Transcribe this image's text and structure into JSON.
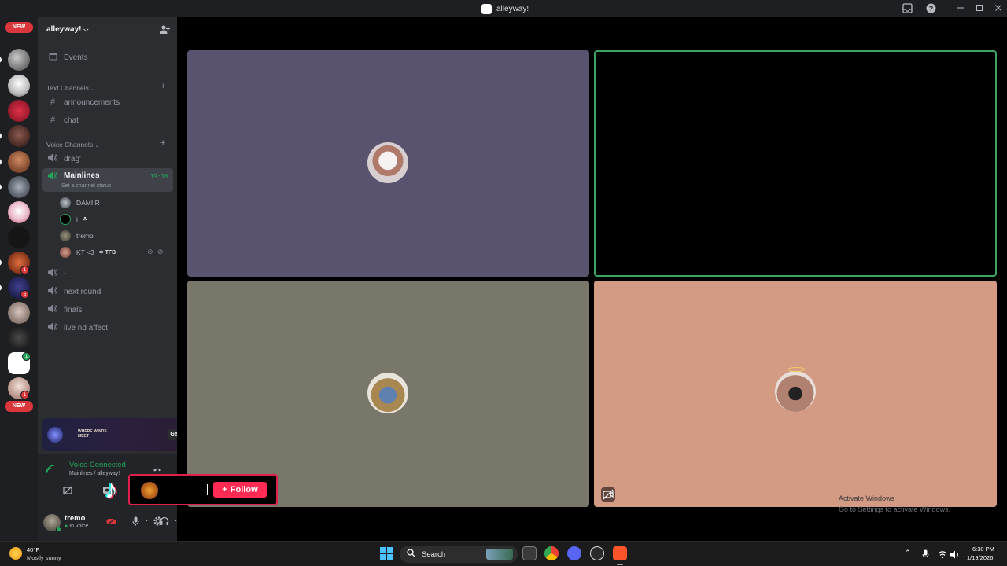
{
  "window": {
    "title": "alleyway!"
  },
  "server_rail": {
    "new_badge_top": "NEW",
    "new_badge_bottom": "NEW",
    "mentions": [
      "1",
      "5",
      "1",
      "1"
    ]
  },
  "guild": {
    "name": "alleyway!"
  },
  "channels": {
    "events_label": "Events",
    "text_category": "Text Channels",
    "text": [
      "announcements",
      "chat"
    ],
    "voice_category": "Voice Channels",
    "voice_first": "drag'",
    "active_voice": {
      "name": "Mainlines",
      "timer": "19:16",
      "status": "Set a channel status"
    },
    "members": [
      {
        "name": "DAMIIR",
        "tag": ""
      },
      {
        "name": "i",
        "tag": ""
      },
      {
        "name": "tremo",
        "tag": ""
      },
      {
        "name": "KT <3",
        "tag": "TFB"
      }
    ],
    "voice_rest": [
      "-",
      "next round",
      "finals",
      "live nd affect"
    ]
  },
  "promo": {
    "brand": "WHERE WINDS MEET",
    "button": "Get Reward!"
  },
  "voice_panel": {
    "status": "Voice Connected",
    "location": "Mainlines / alleyway!"
  },
  "user": {
    "name": "tremo",
    "status": "In voice"
  },
  "tiktok": {
    "follow": "Follow"
  },
  "activation": {
    "line1": "Activate Windows",
    "line2": "Go to Settings to activate Windows."
  },
  "taskbar": {
    "weather_temp": "40°F",
    "weather_desc": "Mostly sunny",
    "search_placeholder": "Search",
    "time": "6:30 PM",
    "date": "1/19/2026"
  },
  "colors": {
    "tile1": "#5a5370",
    "tile2": "#000000",
    "tile3": "#79776a",
    "tile4": "#d39a84",
    "speaking": "#3ba55d",
    "connected": "#23a55a"
  }
}
